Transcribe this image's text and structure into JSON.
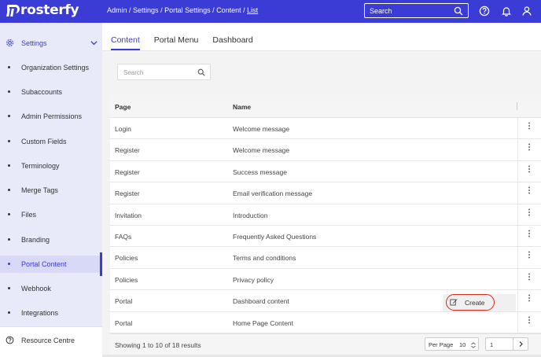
{
  "brand": {
    "name": "rosterfy"
  },
  "breadcrumb": [
    "Admin",
    "Settings",
    "Portal Settings",
    "Content",
    "List"
  ],
  "breadcrumb_separator": " / ",
  "top_search": {
    "placeholder": "Search"
  },
  "top_icons": [
    "help-icon",
    "bell-icon",
    "user-icon"
  ],
  "sidebar": {
    "section_label": "Settings",
    "items": [
      {
        "label": "Organization Settings"
      },
      {
        "label": "Subaccounts"
      },
      {
        "label": "Admin Permissions"
      },
      {
        "label": "Custom Fields"
      },
      {
        "label": "Terminology"
      },
      {
        "label": "Merge Tags"
      },
      {
        "label": "Files"
      },
      {
        "label": "Branding"
      },
      {
        "label": "Portal Content",
        "active": true
      },
      {
        "label": "Webhook"
      },
      {
        "label": "Integrations"
      }
    ],
    "resource_label": "Resource Centre"
  },
  "tabs": [
    {
      "label": "Content",
      "active": true
    },
    {
      "label": "Portal Menu"
    },
    {
      "label": "Dashboard"
    }
  ],
  "table_search": {
    "placeholder": "Search"
  },
  "table": {
    "columns": [
      "Page",
      "Name"
    ],
    "rows": [
      {
        "page": "Login",
        "name": "Welcome message"
      },
      {
        "page": "Register",
        "name": "Welcome message"
      },
      {
        "page": "Register",
        "name": "Success message"
      },
      {
        "page": "Register",
        "name": "Email verification message"
      },
      {
        "page": "Invitation",
        "name": "Introduction"
      },
      {
        "page": "FAQs",
        "name": "Frequently Asked Questions"
      },
      {
        "page": "Policies",
        "name": "Terms and conditions"
      },
      {
        "page": "Policies",
        "name": "Privacy policy"
      },
      {
        "page": "Portal",
        "name": "Dashboard content"
      },
      {
        "page": "Portal",
        "name": "Home Page Content"
      }
    ],
    "row_menu_glyph": "⋮"
  },
  "create_menu": {
    "label": "Create"
  },
  "footer": {
    "info": "Showing 1 to 10 of 18 results",
    "per_page_label": "Per Page",
    "per_page_value": "10",
    "page_value": "1"
  },
  "colors": {
    "brand": "#3b3bd6",
    "sidebar_bg": "#e8e9f9",
    "highlight": "#d9291c"
  }
}
